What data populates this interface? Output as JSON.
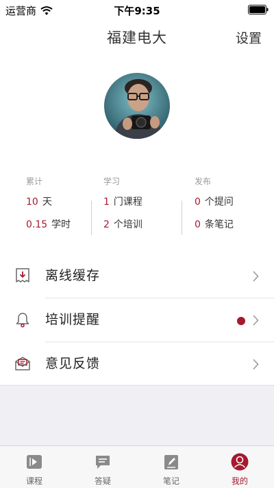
{
  "status_bar": {
    "carrier": "运营商",
    "time": "下午9:35"
  },
  "header": {
    "title": "福建电大",
    "settings_label": "设置"
  },
  "colors": {
    "accent": "#a6192e",
    "muted": "#9a9a9a",
    "background_gray": "#efeff4"
  },
  "stats": {
    "columns": [
      {
        "heading": "累计",
        "lines": [
          {
            "value": "10",
            "unit": "天"
          },
          {
            "value": "0.15",
            "unit": "学时"
          }
        ]
      },
      {
        "heading": "学习",
        "lines": [
          {
            "value": "1",
            "unit": "门课程"
          },
          {
            "value": "2",
            "unit": "个培训"
          }
        ]
      },
      {
        "heading": "发布",
        "lines": [
          {
            "value": "0",
            "unit": "个提问"
          },
          {
            "value": "0",
            "unit": "条笔记"
          }
        ]
      }
    ]
  },
  "menu": {
    "items": [
      {
        "label": "离线缓存",
        "icon": "download-cache-icon"
      },
      {
        "label": "培训提醒",
        "icon": "bell-icon",
        "badge": "red-dot"
      },
      {
        "label": "意见反馈",
        "icon": "feedback-mail-icon"
      }
    ]
  },
  "tabbar": {
    "tabs": [
      {
        "label": "课程",
        "icon": "course-video-icon",
        "active": false
      },
      {
        "label": "答疑",
        "icon": "qa-chat-icon",
        "active": false
      },
      {
        "label": "笔记",
        "icon": "note-edit-icon",
        "active": false
      },
      {
        "label": "我的",
        "icon": "profile-user-icon",
        "active": true
      }
    ]
  }
}
